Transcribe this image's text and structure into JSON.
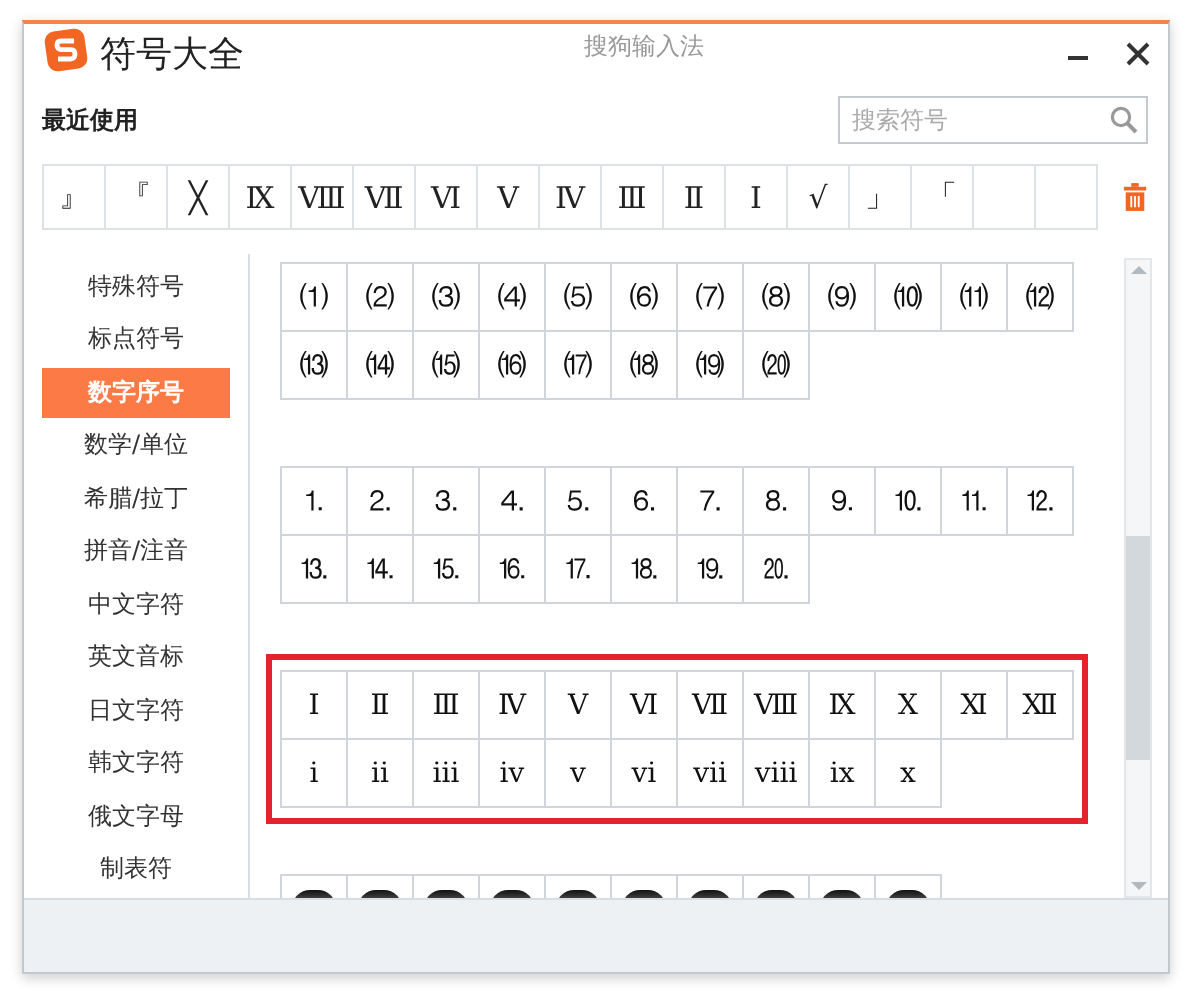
{
  "window": {
    "title": "符号大全",
    "app_name": "搜狗输入法"
  },
  "recent": {
    "label": "最近使用",
    "slots": [
      {
        "kind": "symbol",
        "symbol": "』"
      },
      {
        "kind": "symbol",
        "symbol": "『"
      },
      {
        "kind": "symbol",
        "symbol": "╳"
      },
      {
        "kind": "symbol",
        "symbol": "Ⅸ"
      },
      {
        "kind": "symbol",
        "symbol": "Ⅷ"
      },
      {
        "kind": "symbol",
        "symbol": "Ⅶ"
      },
      {
        "kind": "symbol",
        "symbol": "Ⅵ"
      },
      {
        "kind": "symbol",
        "symbol": "Ⅴ"
      },
      {
        "kind": "symbol",
        "symbol": "Ⅳ"
      },
      {
        "kind": "symbol",
        "symbol": "Ⅲ"
      },
      {
        "kind": "symbol",
        "symbol": "Ⅱ"
      },
      {
        "kind": "symbol",
        "symbol": "Ⅰ"
      },
      {
        "kind": "symbol",
        "symbol": "√"
      },
      {
        "kind": "symbol",
        "symbol": "」"
      },
      {
        "kind": "symbol",
        "symbol": "「"
      },
      {
        "kind": "empty"
      },
      {
        "kind": "empty"
      }
    ]
  },
  "search": {
    "placeholder": "搜索符号"
  },
  "sidebar": {
    "items": [
      {
        "label": "特殊符号",
        "selected": false
      },
      {
        "label": "标点符号",
        "selected": false
      },
      {
        "label": "数字序号",
        "selected": true
      },
      {
        "label": "数学/单位",
        "selected": false
      },
      {
        "label": "希腊/拉丁",
        "selected": false
      },
      {
        "label": "拼音/注音",
        "selected": false
      },
      {
        "label": "中文字符",
        "selected": false
      },
      {
        "label": "英文音标",
        "selected": false
      },
      {
        "label": "日文字符",
        "selected": false
      },
      {
        "label": "韩文字符",
        "selected": false
      },
      {
        "label": "俄文字母",
        "selected": false
      },
      {
        "label": "制表符",
        "selected": false
      }
    ]
  },
  "groups": [
    {
      "kind": "symbols",
      "highlighted": false,
      "rows": [
        [
          "⑴",
          "⑵",
          "⑶",
          "⑷",
          "⑸",
          "⑹",
          "⑺",
          "⑻",
          "⑼",
          "⑽",
          "⑾",
          "⑿"
        ],
        [
          "⒀",
          "⒁",
          "⒂",
          "⒃",
          "⒄",
          "⒅",
          "⒆",
          "⒇"
        ]
      ]
    },
    {
      "kind": "symbols",
      "highlighted": false,
      "rows": [
        [
          "⒈",
          "⒉",
          "⒊",
          "⒋",
          "⒌",
          "⒍",
          "⒎",
          "⒏",
          "⒐",
          "⒑",
          "⒒",
          "⒓"
        ],
        [
          "⒔",
          "⒕",
          "⒖",
          "⒗",
          "⒘",
          "⒙",
          "⒚",
          "⒛"
        ]
      ]
    },
    {
      "kind": "symbols",
      "highlighted": true,
      "rows": [
        [
          "Ⅰ",
          "Ⅱ",
          "Ⅲ",
          "Ⅳ",
          "Ⅴ",
          "Ⅵ",
          "Ⅶ",
          "Ⅷ",
          "Ⅸ",
          "Ⅹ",
          "Ⅺ",
          "Ⅻ"
        ],
        [
          "ⅰ",
          "ⅱ",
          "ⅲ",
          "ⅳ",
          "ⅴ",
          "ⅵ",
          "ⅶ",
          "ⅷ",
          "ⅸ",
          "ⅹ"
        ]
      ]
    },
    {
      "kind": "clipped",
      "highlighted": false,
      "cells": [
        {
          "kind": "dark-circle"
        },
        {
          "kind": "dark-circle"
        },
        {
          "kind": "dark-circle"
        },
        {
          "kind": "dark-circle"
        },
        {
          "kind": "dark-circle"
        },
        {
          "kind": "dark-circle"
        },
        {
          "kind": "dark-circle"
        },
        {
          "kind": "dark-circle"
        },
        {
          "kind": "dark-circle"
        },
        {
          "kind": "dark-circle"
        }
      ]
    }
  ]
}
